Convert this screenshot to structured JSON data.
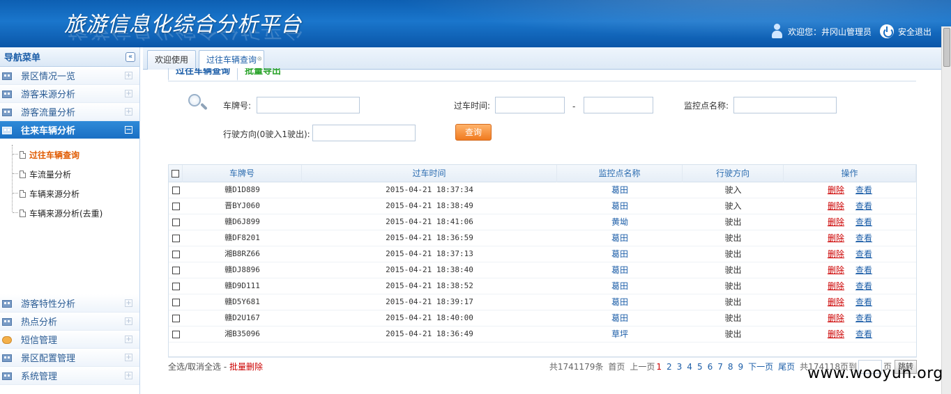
{
  "header": {
    "title": "旅游信息化综合分析平台",
    "welcome": "欢迎您：",
    "username": "井冈山管理员",
    "logout": "安全退出"
  },
  "sidebar": {
    "title": "导航菜单",
    "collapse_glyph": "«",
    "top_items": [
      {
        "label": "景区情况一览",
        "icon": "building-icon"
      },
      {
        "label": "游客来源分析",
        "icon": "building-icon"
      },
      {
        "label": "游客流量分析",
        "icon": "building-icon"
      },
      {
        "label": "往来车辆分析",
        "icon": "building-icon",
        "active": true
      }
    ],
    "sub_items": [
      {
        "label": "过往车辆查询",
        "active": true
      },
      {
        "label": "车流量分析"
      },
      {
        "label": "车辆来源分析"
      },
      {
        "label": "车辆来源分析(去重)"
      }
    ],
    "bottom_items": [
      {
        "label": "游客特性分析",
        "icon": "building-icon"
      },
      {
        "label": "热点分析",
        "icon": "building-icon"
      },
      {
        "label": "短信管理",
        "icon": "chat-bubble-icon"
      },
      {
        "label": "景区配置管理",
        "icon": "building-icon"
      },
      {
        "label": "系统管理",
        "icon": "building-icon"
      }
    ]
  },
  "tabs": [
    {
      "label": "欢迎使用"
    },
    {
      "label": "过往车辆查询",
      "active": true
    }
  ],
  "subtabs": [
    "过往车辆查询",
    "批量导出"
  ],
  "search": {
    "plate_label": "车牌号:",
    "time_label": "过车时间:",
    "time_sep": "-",
    "point_label": "监控点名称:",
    "direction_label": "行驶方向(0驶入1驶出):",
    "query_button": "查询"
  },
  "table": {
    "headers": [
      "车牌号",
      "过车时间",
      "监控点名称",
      "行驶方向",
      "操作"
    ],
    "delete_label": "删除",
    "view_label": "查看",
    "rows": [
      [
        "赣D1D889",
        "2015-04-21 18:37:34",
        "葛田",
        "驶入"
      ],
      [
        "晋BYJ060",
        "2015-04-21 18:38:49",
        "葛田",
        "驶入"
      ],
      [
        "赣D6J899",
        "2015-04-21 18:41:06",
        "黄坳",
        "驶出"
      ],
      [
        "赣DF8201",
        "2015-04-21 18:36:59",
        "葛田",
        "驶出"
      ],
      [
        "湘B8RZ66",
        "2015-04-21 18:37:13",
        "葛田",
        "驶出"
      ],
      [
        "赣DJ8896",
        "2015-04-21 18:38:40",
        "葛田",
        "驶出"
      ],
      [
        "赣D9D111",
        "2015-04-21 18:38:52",
        "葛田",
        "驶出"
      ],
      [
        "赣D5Y681",
        "2015-04-21 18:39:17",
        "葛田",
        "驶出"
      ],
      [
        "赣D2U167",
        "2015-04-21 18:40:00",
        "葛田",
        "驶出"
      ],
      [
        "湘B35096",
        "2015-04-21 18:36:49",
        "草坪",
        "驶出"
      ]
    ]
  },
  "footer": {
    "select_all": "全选/取消全选",
    "sep": " - ",
    "batch_delete": "批量删除",
    "total": "共1741179条",
    "first": "首页",
    "prev": "上一页",
    "pages": [
      "1",
      "2",
      "3",
      "4",
      "5",
      "6",
      "7",
      "8",
      "9"
    ],
    "current_page": "1",
    "next": "下一页",
    "last": "尾页",
    "total_pages": "共174118页到",
    "page_unit": "页",
    "jump": "跳转"
  },
  "watermark": "www.wooyun.org"
}
